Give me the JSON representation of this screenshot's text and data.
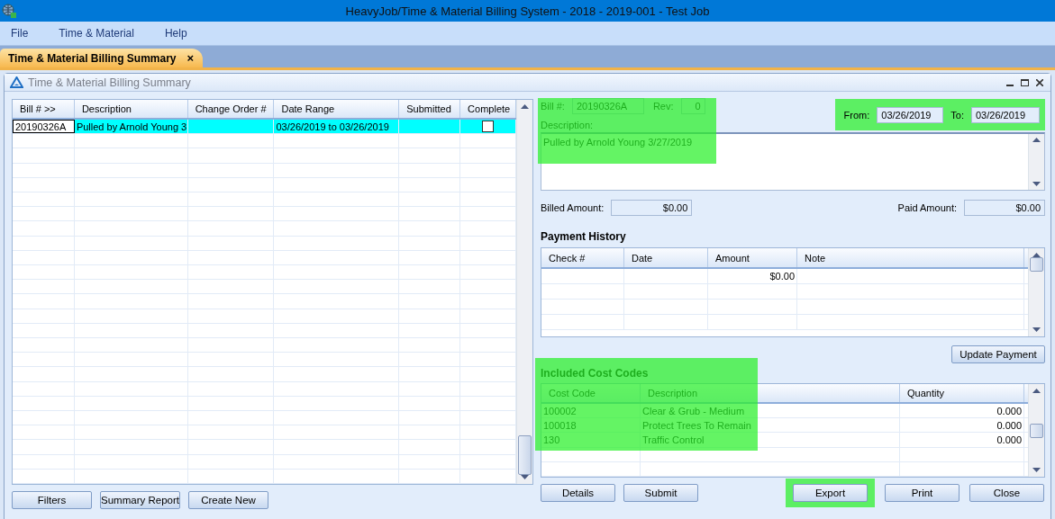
{
  "window": {
    "title": "HeavyJob/Time & Material Billing System - 2018 - 2019-001 - Test Job"
  },
  "menu": [
    "File",
    "Time & Material",
    "Help"
  ],
  "tabs": [
    {
      "label": "Time & Material Billing Summary",
      "selected": true,
      "close": "×"
    }
  ],
  "panel": {
    "title": "Time & Material Billing Summary"
  },
  "bills": {
    "columns": [
      "Bill # >>",
      "Description",
      "Change Order #",
      "Date Range",
      "Submitted",
      "Complete"
    ],
    "rows": [
      {
        "cells": [
          "20190326A",
          "Pulled by Arnold Young 3",
          "",
          "03/26/2019 to 03/26/2019",
          ""
        ],
        "complete": false,
        "selected": true
      }
    ],
    "buttons": [
      "Filters",
      "Summary Report",
      "Create New"
    ]
  },
  "detail": {
    "highlighted": true,
    "bill_label": "Bill #:",
    "bill": "20190326A",
    "rev_label": "Rev:",
    "rev": "0",
    "description_label": "Description:",
    "description": "Pulled by Arnold Young 3/27/2019"
  },
  "dates": {
    "highlighted": true,
    "from_label": "From:",
    "from": "03/26/2019",
    "to_label": "To:",
    "to": "03/26/2019"
  },
  "amounts": {
    "billed_label": "Billed Amount:",
    "billed": "$0.00",
    "paid_label": "Paid Amount:",
    "paid": "$0.00"
  },
  "payment_history": {
    "title": "Payment History",
    "columns": [
      "Check #",
      "Date",
      "Amount",
      "Note"
    ],
    "rows": [
      [
        "",
        "",
        "$0.00",
        ""
      ]
    ],
    "button": "Update Payment"
  },
  "cost_codes": {
    "highlighted": true,
    "title": "Included Cost Codes",
    "columns": [
      "Cost Code",
      "Description",
      "Quantity"
    ],
    "rows": [
      [
        "100002",
        "Clear & Grub - Medium",
        "0.000"
      ],
      [
        "100018",
        "Protect Trees To Remain",
        "0.000"
      ],
      [
        "130",
        "Traffic Control",
        "0.000"
      ]
    ]
  },
  "buttons": [
    {
      "label": "Details",
      "highlighted": false
    },
    {
      "label": "Submit",
      "highlighted": false
    },
    {
      "label": "Export",
      "highlighted": true
    },
    {
      "label": "Print",
      "highlighted": false
    },
    {
      "label": "Close",
      "highlighted": false
    }
  ]
}
